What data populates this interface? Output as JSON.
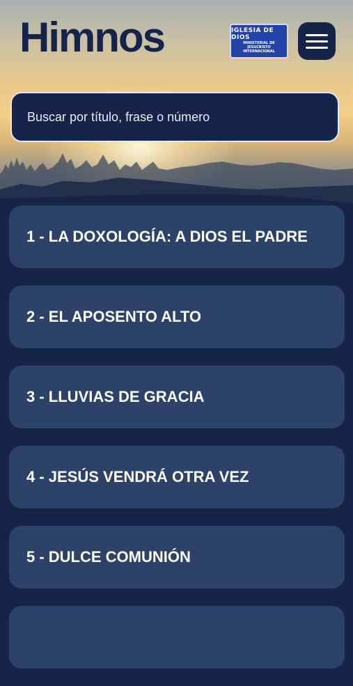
{
  "header": {
    "title": "Himnos",
    "logo": {
      "line1": "IGLESIA DE DIOS",
      "line2": "MINISTERIAL DE JESUCRISTO INTERNACIONAL"
    },
    "menu_icon": "hamburger-menu-icon"
  },
  "search": {
    "placeholder": "Buscar por título, frase o número",
    "value": ""
  },
  "hymns": [
    {
      "label": "1 - LA DOXOLOGÍA: A DIOS EL PADRE"
    },
    {
      "label": "2 - EL APOSENTO ALTO"
    },
    {
      "label": "3 - LLUVIAS DE GRACIA"
    },
    {
      "label": "4 - JESÚS VENDRÁ OTRA VEZ"
    },
    {
      "label": "5 - DULCE COMUNIÓN"
    },
    {
      "label": ""
    }
  ],
  "colors": {
    "background": "#162545",
    "card": "#2d4268",
    "header_navy": "#16244a",
    "logo_blue": "#2443a6"
  }
}
